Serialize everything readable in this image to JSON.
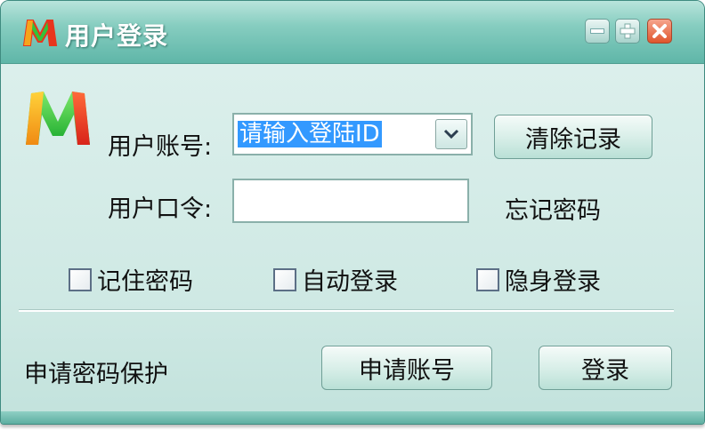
{
  "window": {
    "title": "用户登录"
  },
  "form": {
    "account_label": "用户账号:",
    "account_value": "请输入登陆ID",
    "password_label": "用户口令:",
    "password_value": ""
  },
  "buttons": {
    "clear_records": "清除记录",
    "apply_account": "申请账号",
    "login": "登录"
  },
  "links": {
    "forgot_password": "忘记密码",
    "apply_protection": "申请密码保护"
  },
  "options": {
    "remember_password": {
      "label": "记住密码",
      "checked": false
    },
    "auto_login": {
      "label": "自动登录",
      "checked": false
    },
    "invisible_login": {
      "label": "隐身登录",
      "checked": false
    }
  },
  "icons": {
    "app_logo": "m-logo-icon",
    "minimize": "minimize-icon",
    "maximize": "plus-icon",
    "close": "close-icon",
    "dropdown": "chevron-down-icon"
  },
  "colors": {
    "titlebar": "#6fc0b2",
    "window_bg": "#d3ebe6",
    "close_button": "#e0552c",
    "selection": "#3399ff",
    "logo_left": "#f7a41a",
    "logo_middle": "#22c23a",
    "logo_right": "#e8351d"
  }
}
